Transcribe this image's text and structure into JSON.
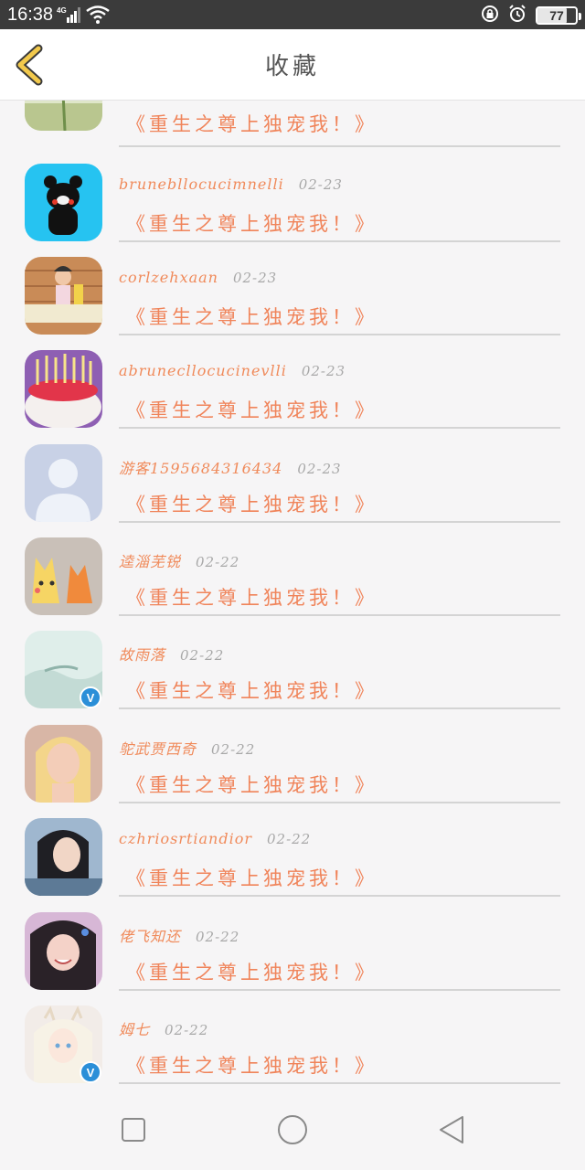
{
  "status": {
    "time": "16:38",
    "network": "4G",
    "battery": "77",
    "battery_level": 0.77,
    "icons": [
      "signal-icon",
      "wifi-icon",
      "lock-rotation-icon",
      "alarm-icon",
      "battery-icon"
    ]
  },
  "header": {
    "title": "收藏",
    "back_icon": "chevron-left-icon",
    "accent": "#f2c94c"
  },
  "items": [
    {
      "username": "",
      "date": "",
      "title": "《重生之尊上独宠我！》",
      "avatar": "flower",
      "verified": false
    },
    {
      "username": "brunebllocucimnelli",
      "date": "02-23",
      "title": "《重生之尊上独宠我！》",
      "avatar": "bear",
      "verified": false
    },
    {
      "username": "corlzehxaan",
      "date": "02-23",
      "title": "《重生之尊上独宠我！》",
      "avatar": "girl-wall",
      "verified": false
    },
    {
      "username": "abrunecllocucinevlli",
      "date": "02-23",
      "title": "《重生之尊上独宠我！》",
      "avatar": "cake",
      "verified": false
    },
    {
      "username": "游客1595684316434",
      "date": "02-23",
      "title": "《重生之尊上独宠我！》",
      "avatar": "default",
      "verified": false
    },
    {
      "username": "逵淄芜锐",
      "date": "02-22",
      "title": "《重生之尊上独宠我！》",
      "avatar": "pikachu",
      "verified": false
    },
    {
      "username": "故雨落",
      "date": "02-22",
      "title": "《重生之尊上独宠我！》",
      "avatar": "mist",
      "verified": true
    },
    {
      "username": "鸵武贾西奇",
      "date": "02-22",
      "title": "《重生之尊上独宠我！》",
      "avatar": "blonde",
      "verified": false
    },
    {
      "username": "czhriosrtiandior",
      "date": "02-22",
      "title": "《重生之尊上独宠我！》",
      "avatar": "dark-hair",
      "verified": false
    },
    {
      "username": "佬飞知还",
      "date": "02-22",
      "title": "《重生之尊上独宠我！》",
      "avatar": "smile",
      "verified": false
    },
    {
      "username": "姆七",
      "date": "02-22",
      "title": "《重生之尊上独宠我！》",
      "avatar": "anime",
      "verified": true
    }
  ],
  "colors": {
    "username": "#f08a5a",
    "title": "#f0845a",
    "date": "#a8a8a8",
    "divider": "#d4d4d4",
    "verified": "#2b8fd8"
  },
  "nav": {
    "icons": [
      "recents-square-icon",
      "home-circle-icon",
      "back-triangle-icon"
    ]
  }
}
